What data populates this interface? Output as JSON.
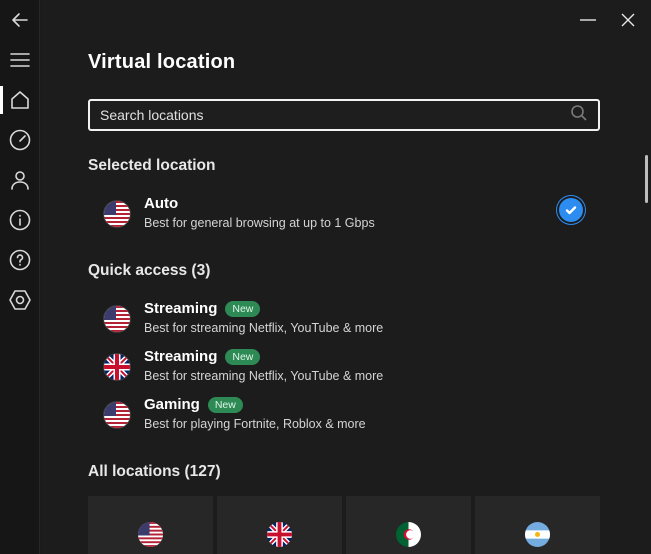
{
  "sidebar": {
    "items": [
      {
        "name": "back-button",
        "icon": "arrow-left-icon"
      },
      {
        "name": "menu-button",
        "icon": "hamburger-icon"
      },
      {
        "name": "home-button",
        "icon": "home-icon",
        "active": true
      },
      {
        "name": "speed-test-button",
        "icon": "gauge-icon"
      },
      {
        "name": "account-button",
        "icon": "person-icon"
      },
      {
        "name": "info-button",
        "icon": "info-icon"
      },
      {
        "name": "help-button",
        "icon": "help-icon"
      },
      {
        "name": "settings-button",
        "icon": "hexagon-settings-icon"
      }
    ]
  },
  "window": {
    "minimize_icon": "minimize-icon",
    "close_icon": "close-icon"
  },
  "page": {
    "title": "Virtual location"
  },
  "search": {
    "placeholder": "Search locations",
    "value": ""
  },
  "selected": {
    "heading": "Selected location",
    "item": {
      "name": "Auto",
      "description": "Best for general browsing at up to 1 Gbps",
      "flag": "us",
      "checked": true
    }
  },
  "quick_access": {
    "heading": "Quick access (3)",
    "items": [
      {
        "name": "Streaming",
        "badge": "New",
        "description": "Best for streaming Netflix, YouTube & more",
        "flag": "us"
      },
      {
        "name": "Streaming",
        "badge": "New",
        "description": "Best for streaming Netflix, YouTube & more",
        "flag": "uk"
      },
      {
        "name": "Gaming",
        "badge": "New",
        "description": "Best for playing Fortnite, Roblox & more",
        "flag": "us"
      }
    ]
  },
  "all_locations": {
    "heading": "All locations (127)",
    "tiles": [
      {
        "flag": "us"
      },
      {
        "flag": "uk"
      },
      {
        "flag": "dz"
      },
      {
        "flag": "ar"
      }
    ]
  },
  "colors": {
    "background": "#1c1c1c",
    "sidebar": "#161616",
    "accent_blue": "#2d8cf0",
    "badge_green": "#2e8a55",
    "tile": "#272727"
  }
}
